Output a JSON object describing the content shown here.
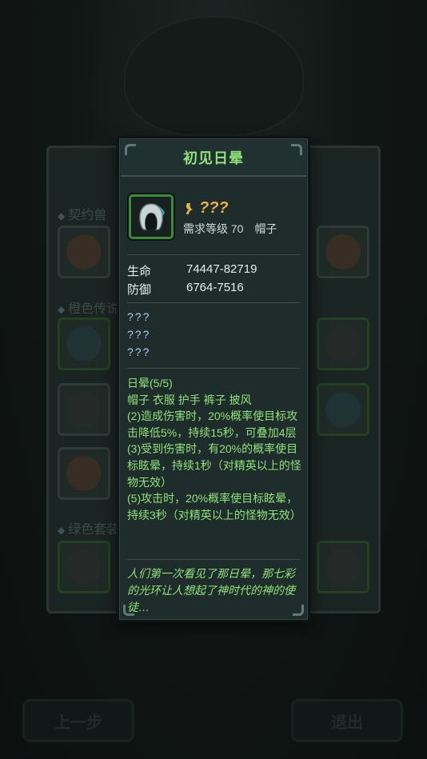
{
  "background": {
    "sections": [
      "契约兽",
      "橙色传说",
      "绿色套装"
    ],
    "buttons": {
      "prev": "上一步",
      "exit": "退出"
    }
  },
  "tooltip": {
    "title": "初见日晕",
    "item": {
      "icon": "hood-icon",
      "name": "???",
      "level_label": "需求等级 70",
      "slot_type": "帽子"
    },
    "stats": [
      {
        "label": "生命",
        "value": "74447-82719"
      },
      {
        "label": "防御",
        "value": "6764-7516"
      }
    ],
    "unknown_affixes": [
      "???",
      "???",
      "???"
    ],
    "set": {
      "name": "日晕(5/5)",
      "pieces": "帽子 衣服 护手 裤子 披风",
      "bonuses": [
        "(2)造成伤害时，20%概率使目标攻击降低5%，持续15秒，可叠加4层",
        "(3)受到伤害时，有20%的概率使目标眩晕，持续1秒（对精英以上的怪物无效）",
        "(5)攻击时，20%概率使目标眩晕，持续3秒（对精英以上的怪物无效）"
      ]
    },
    "flavor": "人们第一次看见了那日晕，那七彩的光环让人想起了神时代的神的使徒…"
  },
  "colors": {
    "title_green": "#8fe37a",
    "name_gold": "#e8b04a",
    "unknown_blue": "#a8d8ee",
    "frame": "#3b5456"
  }
}
